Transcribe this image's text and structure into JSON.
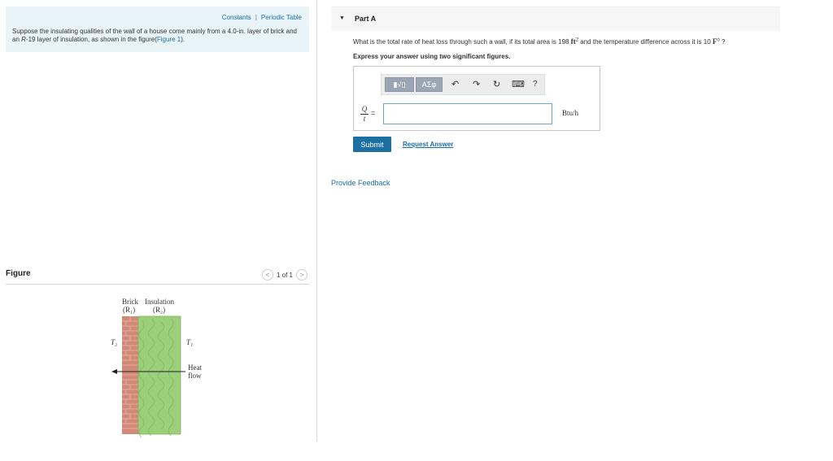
{
  "intro": {
    "links": [
      "Constants",
      "Periodic Table"
    ],
    "text_before_r": "Suppose the insulating qualities of the wall of a house come mainly from a 4.0-in. layer of brick and an ",
    "r_symbol": "R",
    "text_after_r": "-19 layer of insulation, as shown in the figure(",
    "figure_link": "Figure 1",
    "text_end": ")."
  },
  "figure": {
    "title": "Figure",
    "pager_prev": "<",
    "pager_text": "1 of 1",
    "pager_next": ">",
    "labels": {
      "brick": "Brick",
      "r1": "(R₁)",
      "insulation": "Insulation",
      "r2": "(R₂)",
      "t2": "T₂",
      "t1": "T₁",
      "heat": "Heat",
      "flow": "flow"
    },
    "colors": {
      "brick": "#d28a78",
      "mortar": "#e8b7a8",
      "insulation": "#9bcf7a",
      "insulation_lines": "#7fb35f"
    }
  },
  "part": {
    "caret": "▼",
    "title": "Part A",
    "question_before": "What is the total rate of heat loss through such a wall, if its total area is 198 ",
    "question_area_unit": "ft",
    "question_area_exp": "2",
    "question_middle": " and the temperature difference across it is 10 ",
    "question_temp_unit": "F",
    "question_temp_deg": "o",
    "question_end": " ?",
    "instruction": "Express your answer using two significant figures."
  },
  "answer": {
    "toolbar": {
      "template_btn": "▮√▯",
      "greek_btn": "ΑΣφ",
      "undo_icon": "↶",
      "redo_icon": "↷",
      "reset_icon": "↻",
      "keyboard_icon": "⌨",
      "help_icon": "?"
    },
    "fraction_num": "Q",
    "fraction_den": "t",
    "equals": "=",
    "value": "",
    "unit": "Btu/h"
  },
  "actions": {
    "submit": "Submit",
    "request_answer": "Request Answer",
    "feedback": "Provide Feedback"
  }
}
